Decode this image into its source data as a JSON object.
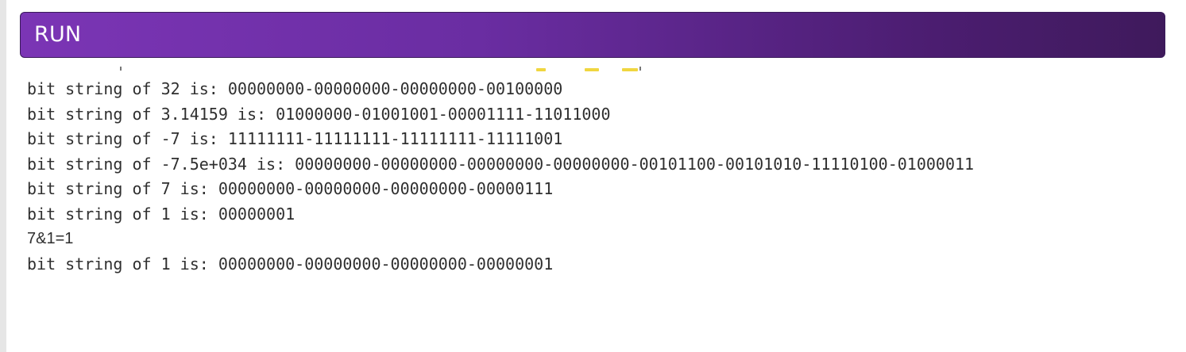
{
  "header": {
    "run_label": "RUN"
  },
  "console": {
    "lines": [
      "bit string of 32 is: 00000000-00000000-00000000-00100000",
      "bit string of 3.14159 is: 01000000-01001001-00001111-11011000",
      "bit string of -7 is: 11111111-11111111-11111111-11111001",
      "bit string of -7.5e+034 is: 00000000-00000000-00000000-00000000-00101100-00101010-11110100-01000011",
      "bit string of 7 is: 00000000-00000000-00000000-00000111",
      "bit string of 1 is: 00000001",
      "7&1=1",
      "bit string of 1 is: 00000000-00000000-00000000-00000001"
    ]
  },
  "colors": {
    "run_bar_start": "#7b35b5",
    "run_bar_end": "#3f1a5c",
    "text": "#2f2f2f"
  }
}
